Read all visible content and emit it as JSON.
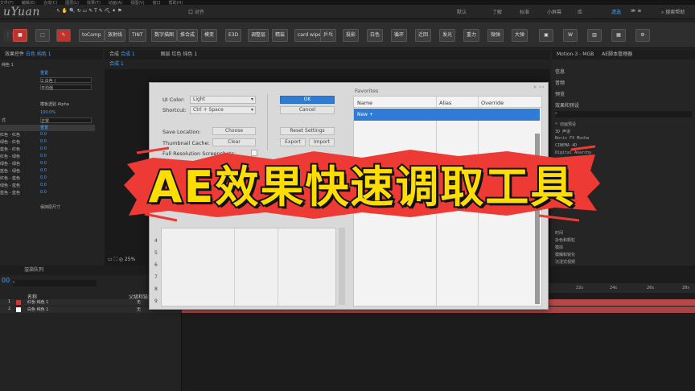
{
  "app": {
    "watermark": "uYuan",
    "menu_items": [
      "文件(F)",
      "编辑(E)",
      "合成(C)",
      "图层(L)",
      "效果(T)",
      "动画(A)",
      "视图(V)",
      "窗口",
      "帮助(H)"
    ],
    "workspaces": [
      "默认",
      "了解",
      "标准",
      "小屏幕",
      "库"
    ],
    "active_workspace": "滤选",
    "search_help": "搜索帮助",
    "snap_label": "口 对齐"
  },
  "toolbar": {
    "buttons": [
      "toComp",
      "放射线",
      "TINT",
      "数字描图",
      "推合成",
      "模变",
      "E3D",
      "调整层",
      "精装",
      "card wipe",
      "乒乓",
      "投影",
      "白色",
      "循环",
      "迁回",
      "发光",
      "重力",
      "微弹",
      "大弹"
    ]
  },
  "effects_panel": {
    "tab_label": "效果控件",
    "tab_target": "白色 纯色 1",
    "layer_label": "纯色 1",
    "reset_label": "重置",
    "dropdown_1": "2.白色 (",
    "dropdown_2": "平均值",
    "checkbox_label": "模板透验 Alpha",
    "opacity_value": "100.0%",
    "mode_label": "式",
    "mode_value": "正常",
    "reset_label_2": "重置",
    "channel_rows": [
      {
        "label": "红色 - 红色",
        "value": "0.0"
      },
      {
        "label": "绿色 - 红色",
        "value": "0.0"
      },
      {
        "label": "蓝色 - 红色",
        "value": "0.0"
      },
      {
        "label": "红色 - 绿色",
        "value": "0.0"
      },
      {
        "label": "绿色 - 绿色",
        "value": "0.0"
      },
      {
        "label": "蓝色 - 绿色",
        "value": "0.0"
      },
      {
        "label": "红色 - 蓝色",
        "value": "0.0"
      },
      {
        "label": "绿色 - 蓝色",
        "value": "0.0"
      },
      {
        "label": "蓝色 - 蓝色",
        "value": "0.0"
      }
    ],
    "keep_size_label": "保持原尺寸"
  },
  "comp_panel": {
    "tab_label": "合成",
    "tab_target": "合成 1",
    "layer_tab": "图层 红色 纯色 1",
    "sub_tab": "合成 1",
    "zoom": "25%"
  },
  "right_panel": {
    "tabs": [
      "Motion-3 - MGB",
      "AE脚本管理器"
    ],
    "items": [
      "信息",
      "音频",
      "预览",
      "效果和预设"
    ],
    "presets": [
      "* 动画预设",
      "3D 声道",
      "Boris FX Mocha",
      "CINEMA 4D",
      "Digital Anarchy"
    ],
    "bottom_items": [
      "时间",
      "杂色和颗粒",
      "模拟",
      "模糊和锐化",
      "沉浸式视频"
    ]
  },
  "timeline": {
    "tab_label": "渲染队列",
    "timecode": "00",
    "columns": {
      "name": "名称",
      "parent": "父级和链接"
    },
    "layers": [
      {
        "index": "1",
        "name": "红色 纯色 1",
        "color": "#e03030",
        "parent": "无"
      },
      {
        "index": "2",
        "name": "白色 纯色 1",
        "color": "#ffffff",
        "parent": "无"
      }
    ],
    "ruler": [
      "22s",
      "24s",
      "26s",
      "28s"
    ]
  },
  "dialog": {
    "ui_color_label": "UI Color:",
    "ui_color_value": "Light",
    "shortcut_label": "Shortcut:",
    "shortcut_value": "Ctrl + Space",
    "save_location_label": "Save Location:",
    "choose_label": "Choose",
    "thumbnail_cache_label": "Thumbnail Cache:",
    "clear_label": "Clear",
    "full_res_label": "Full Resolution Screenshots:",
    "ok_label": "OK",
    "cancel_label": "Cancel",
    "reset_settings_label": "Reset Settings",
    "export_label": "Export",
    "import_label": "Import",
    "close_label": "× ∘∘",
    "row_numbers": [
      "4",
      "5",
      "6",
      "7",
      "8",
      "9"
    ],
    "favorites_title": "Favorites",
    "fav_columns": {
      "name": "Name",
      "alias": "Alias",
      "override": "Override"
    },
    "fav_rows": [
      {
        "name": "New +"
      }
    ]
  },
  "banner": {
    "text": "AE效果快速调取工具",
    "fill": "#ffdd00",
    "stroke": "#111111",
    "brush_color": "#ee3a34"
  }
}
